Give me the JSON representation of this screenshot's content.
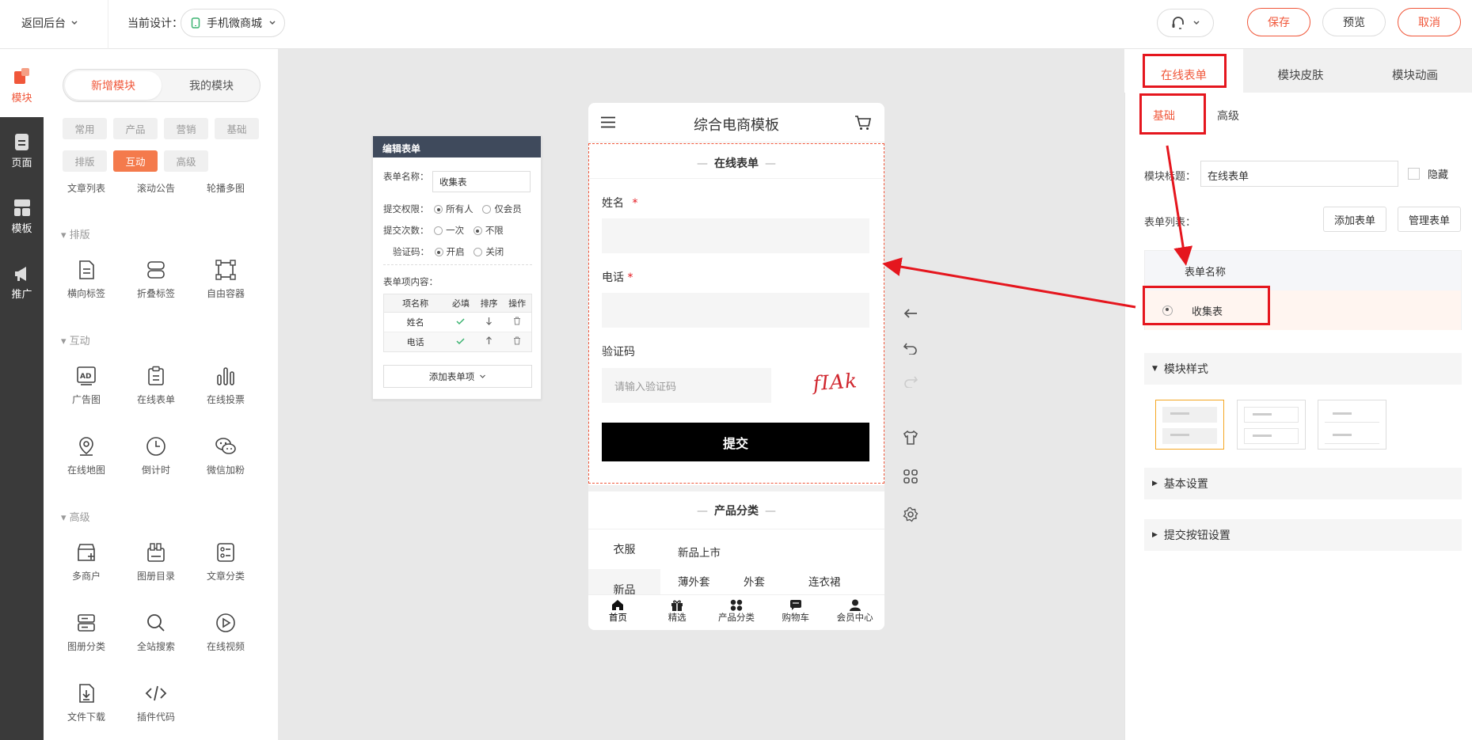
{
  "topbar": {
    "back": "返回后台",
    "current_label": "当前设计：",
    "current_design": "手机微商城",
    "save": "保存",
    "preview": "预览",
    "cancel": "取消"
  },
  "rail": [
    "模块",
    "页面",
    "模板",
    "推广"
  ],
  "panel": {
    "tab_new": "新增模块",
    "tab_mine": "我的模块",
    "chips": [
      "常用",
      "产品",
      "营销",
      "基础",
      "排版",
      "互动",
      "高级"
    ],
    "top_items": [
      "文章列表",
      "滚动公告",
      "轮播多图"
    ],
    "sections": [
      {
        "title": "排版",
        "items": [
          "横向标签",
          "折叠标签",
          "自由容器"
        ]
      },
      {
        "title": "互动",
        "items": [
          "广告图",
          "在线表单",
          "在线投票",
          "在线地图",
          "倒计时",
          "微信加粉"
        ]
      },
      {
        "title": "高级",
        "items": [
          "多商户",
          "图册目录",
          "文章分类",
          "图册分类",
          "全站搜索",
          "在线视频",
          "文件下载",
          "插件代码"
        ]
      }
    ]
  },
  "editcard": {
    "title": "编辑表单",
    "name_label": "表单名称：",
    "name_value": "收集表",
    "perm_label": "提交权限：",
    "perm_opts": [
      "所有人",
      "仅会员"
    ],
    "count_label": "提交次数：",
    "count_opts": [
      "一次",
      "不限"
    ],
    "captcha_label": "验证码：",
    "captcha_opts": [
      "开启",
      "关闭"
    ],
    "items_label": "表单项内容：",
    "table_headers": [
      "项名称",
      "必填",
      "排序",
      "操作"
    ],
    "rows": [
      "姓名",
      "电话"
    ],
    "add_btn": "添加表单项"
  },
  "phone": {
    "title": "综合电商模板",
    "form_title": "在线表单",
    "field1": "姓名",
    "field2": "电话",
    "required_mark": "*",
    "captcha_label": "验证码",
    "captcha_placeholder": "请输入验证码",
    "captcha_text": "fIAk",
    "submit": "提交",
    "cat_title": "产品分类",
    "cat_left": [
      "衣服",
      "新品"
    ],
    "cat_sub": "新品上市",
    "cat_items": [
      "薄外套",
      "外套",
      "连衣裙"
    ],
    "bottom_nav": [
      "首页",
      "精选",
      "产品分类",
      "购物车",
      "会员中心"
    ]
  },
  "rpanel": {
    "tabs": [
      "在线表单",
      "模块皮肤",
      "模块动画"
    ],
    "subtabs": [
      "基础",
      "高级"
    ],
    "module_title_label": "模块标题：",
    "module_title_value": "在线表单",
    "hide_label": "隐藏",
    "form_list_label": "表单列表：",
    "add_form": "添加表单",
    "manage_form": "管理表单",
    "table_header": "表单名称",
    "table_row": "收集表",
    "sections": [
      "模块样式",
      "基本设置",
      "提交按钮设置"
    ]
  },
  "colors": {
    "accent": "#f0573a",
    "annotation": "#e5161e"
  }
}
